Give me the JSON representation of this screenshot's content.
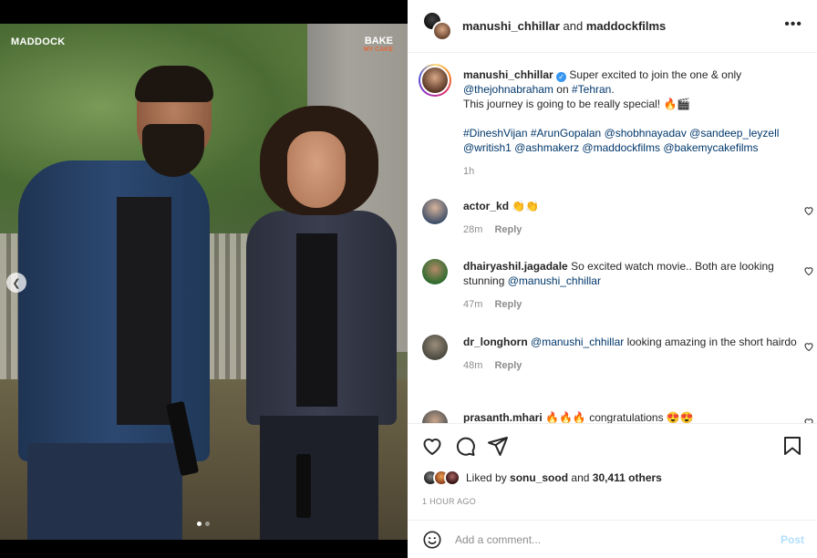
{
  "media": {
    "logo_left": "MADDOCK",
    "logo_right_top": "BAKE",
    "logo_right_bottom": "MY CAKE",
    "prev_icon": "chevron-left-icon",
    "carousel_dots": 2,
    "carousel_active": 0
  },
  "header": {
    "user1": "manushi_chhillar",
    "joiner": "and",
    "user2": "maddockfilms",
    "more_icon": "more-horizontal-icon"
  },
  "caption": {
    "username": "manushi_chhillar",
    "verified_icon": "verified-badge-icon",
    "text_1": "Super excited to join the one & only",
    "mention_1": "@thejohnabraham",
    "text_2": "on",
    "hashtag_tehran": "#Tehran.",
    "line_2": "This journey is going to be really special! 🔥🎬",
    "tags_line_1": [
      "#DineshVijan",
      "#ArunGopalan",
      "@shobhnayadav",
      "@sandeep_leyzell"
    ],
    "tags_line_2": [
      "@writish1",
      "@ashmakerz",
      "@maddockfilms",
      "@bakemycakefilms"
    ],
    "time": "1h"
  },
  "comments": [
    {
      "username": "actor_kd",
      "text": "👏👏",
      "mention": "",
      "time": "28m",
      "reply": "Reply"
    },
    {
      "username": "dhairyashil.jagadale",
      "text": "So excited watch movie.. Both are looking stunning",
      "mention": "@manushi_chhillar",
      "time": "47m",
      "reply": "Reply"
    },
    {
      "username": "dr_longhorn",
      "text": "looking amazing in the short hairdo",
      "mention": "@manushi_chhillar",
      "time": "48m",
      "reply": "Reply"
    },
    {
      "username": "prasanth.mhari",
      "text": "🔥🔥🔥 congratulations 😍😍",
      "mention": "",
      "time": "",
      "reply": ""
    }
  ],
  "actions": {
    "like_icon": "heart-icon",
    "comment_icon": "comment-icon",
    "share_icon": "send-icon",
    "save_icon": "bookmark-icon",
    "liked_prefix": "Liked by",
    "liked_user": "sonu_sood",
    "liked_and": "and",
    "liked_count": "30,411 others",
    "time_ago": "1 HOUR AGO"
  },
  "comment_box": {
    "emoji_icon": "emoji-smile-icon",
    "placeholder": "Add a comment...",
    "post_label": "Post"
  },
  "colors": {
    "link": "#00376b",
    "muted": "#8e8e8e",
    "post_disabled": "#b2dffc",
    "verified": "#3897f0"
  }
}
